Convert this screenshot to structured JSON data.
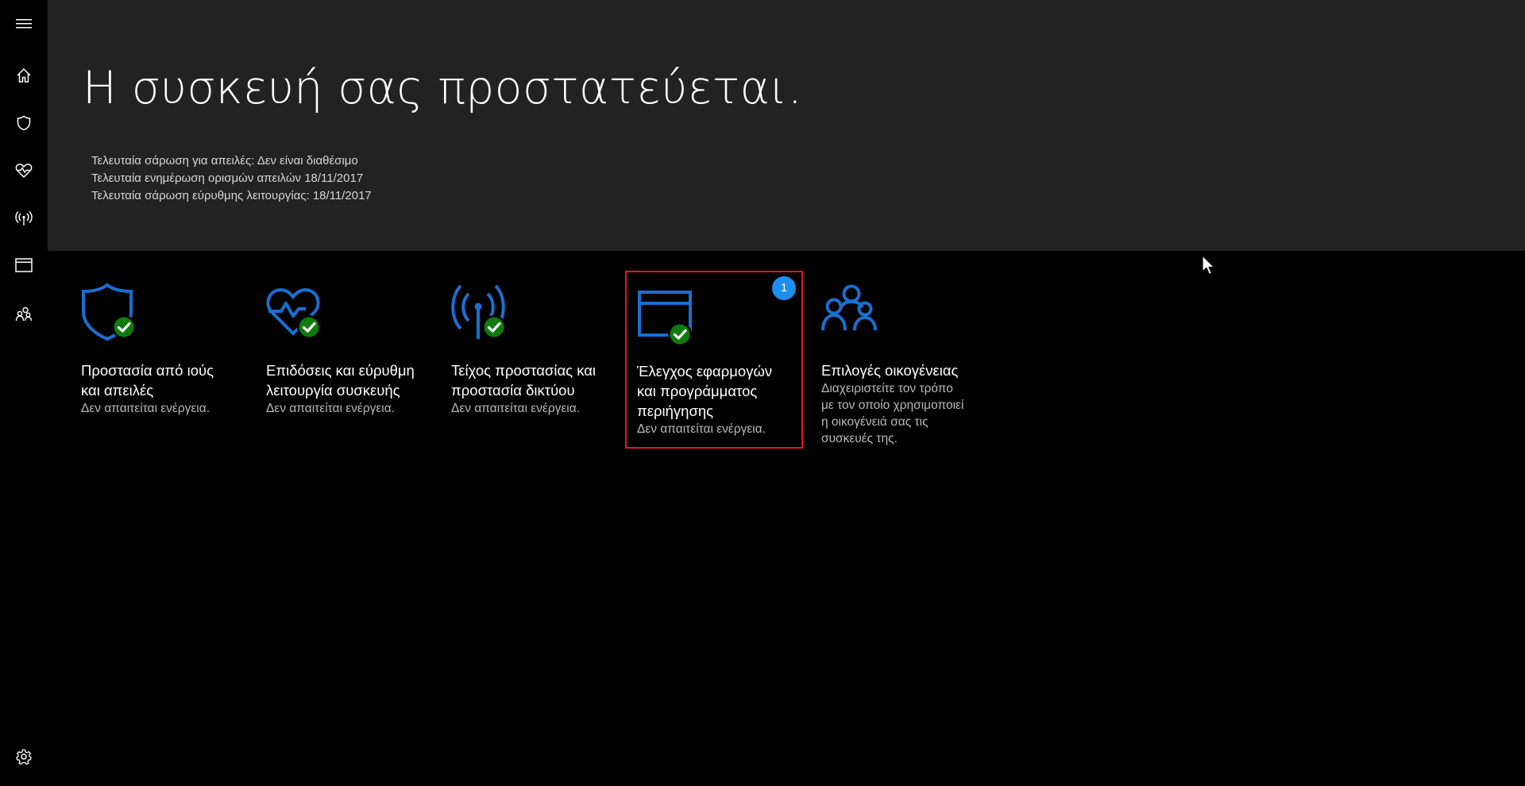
{
  "header": {
    "title": "Η συσκευή σας προστατεύεται.",
    "status_lines": [
      "Τελευταία σάρωση για απειλές: Δεν είναι διαθέσιμο",
      "Τελευταία ενημέρωση ορισμών απειλών 18/11/2017",
      "Τελευταία σάρωση εύρυθμης λειτουργίας: 18/11/2017"
    ]
  },
  "sidebar": {
    "items": [
      {
        "icon": "hamburger-menu-icon"
      },
      {
        "icon": "home-icon"
      },
      {
        "icon": "shield-icon"
      },
      {
        "icon": "heart-pulse-icon"
      },
      {
        "icon": "antenna-icon"
      },
      {
        "icon": "browser-window-icon"
      },
      {
        "icon": "family-icon"
      },
      {
        "icon": "gear-icon"
      }
    ]
  },
  "tiles": [
    {
      "icon": "shield-check-icon",
      "title_line1": "Προστασία από ιούς",
      "title_line2": "και απειλές",
      "title_line3": "",
      "subtitle": "Δεν απαιτείται ενέργεια."
    },
    {
      "icon": "heart-check-icon",
      "title_line1": "Επιδόσεις και εύρυθμη",
      "title_line2": "λειτουργία συσκευής",
      "title_line3": "",
      "subtitle": "Δεν απαιτείται ενέργεια."
    },
    {
      "icon": "antenna-check-icon",
      "title_line1": "Τείχος προστασίας και",
      "title_line2": "προστασία δικτύου",
      "title_line3": "",
      "subtitle": "Δεν απαιτείται ενέργεια."
    },
    {
      "icon": "browser-check-icon",
      "title_line1": "Έλεγχος εφαρμογών",
      "title_line2": "και προγράμματος",
      "title_line3": "περιήγησης",
      "subtitle": "Δεν απαιτείται ενέργεια.",
      "badge": "1"
    },
    {
      "icon": "family-icon",
      "title_line1": "Επιλογές οικογένειας",
      "title_line2": "",
      "title_line3": "",
      "subtitle_lines": [
        "Διαχειριστείτε τον τρόπο",
        "με τον οποίο χρησιμοποιεί",
        "η οικογένειά σας τις",
        "συσκευές της."
      ]
    }
  ],
  "colors": {
    "accent": "#1a6fd1",
    "check": "#0f7b0f",
    "selected_border": "#e81123",
    "badge": "#1e8ff0",
    "header_bg": "#222222"
  }
}
